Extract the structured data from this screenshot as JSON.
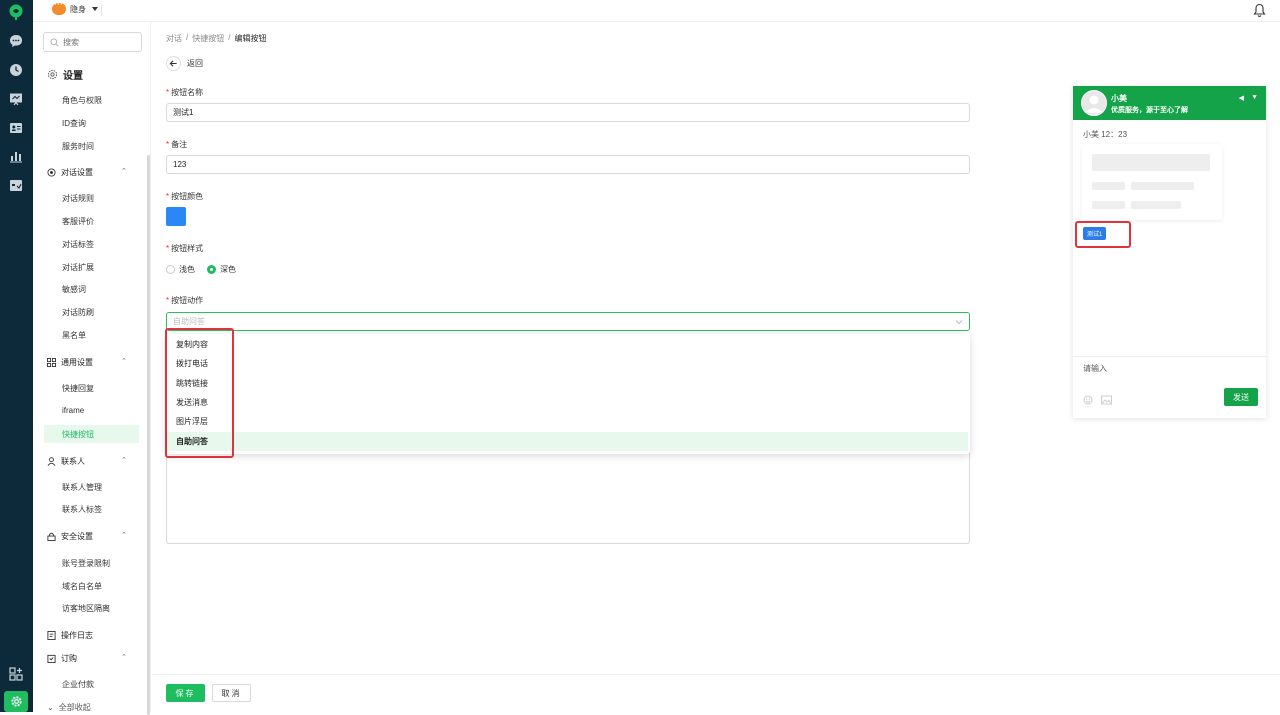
{
  "colors": {
    "brand": "#1fbd60",
    "rail": "#0c2a3a",
    "button_color": "#2b87f5",
    "highlight": "#e0343d",
    "preview_header": "#15a34a"
  },
  "topbar": {
    "status_label": "隐身"
  },
  "sidebar": {
    "search_placeholder": "搜索",
    "settings_title": "设置",
    "top_items": [
      "角色与权限",
      "ID查询",
      "服务时间"
    ],
    "groups": {
      "dialog": {
        "label": "对话设置",
        "items": [
          "对话规则",
          "客服评价",
          "对话标签",
          "对话扩展",
          "敏感词",
          "对话防刷",
          "黑名单"
        ]
      },
      "general": {
        "label": "通用设置",
        "items": [
          "快捷回复",
          "iframe",
          "快捷按钮"
        ]
      },
      "contacts": {
        "label": "联系人",
        "items": [
          "联系人管理",
          "联系人标签"
        ]
      },
      "security": {
        "label": "安全设置",
        "items": [
          "账号登录限制",
          "域名白名单",
          "访客地区隔离"
        ]
      },
      "log": {
        "label": "操作日志"
      },
      "order": {
        "label": "订购",
        "items": [
          "企业付款"
        ]
      }
    },
    "collapse_all": "全部收起"
  },
  "breadcrumb": [
    "对话",
    "快捷按钮",
    "编辑按钮"
  ],
  "back_label": "返回",
  "form": {
    "name": {
      "label": "按钮名称",
      "value": "测试1"
    },
    "note": {
      "label": "备注",
      "value": "123"
    },
    "color": {
      "label": "按钮颜色"
    },
    "style": {
      "label": "按钮样式",
      "options": [
        "浅色",
        "深色"
      ],
      "selected": "深色"
    },
    "action": {
      "label": "按钮动作",
      "placeholder": "自助问答",
      "options": [
        "复制内容",
        "拨打电话",
        "跳转链接",
        "发送消息",
        "图片浮层",
        "自助问答"
      ],
      "selected": "自助问答"
    }
  },
  "actions": {
    "save": "保存",
    "cancel": "取消"
  },
  "preview": {
    "agent_name": "小美",
    "agent_desc": "优质服务，源于至心了解",
    "meta": "小美 12：23",
    "quick_button": "测试1",
    "input_placeholder": "请输入",
    "send": "发送"
  }
}
